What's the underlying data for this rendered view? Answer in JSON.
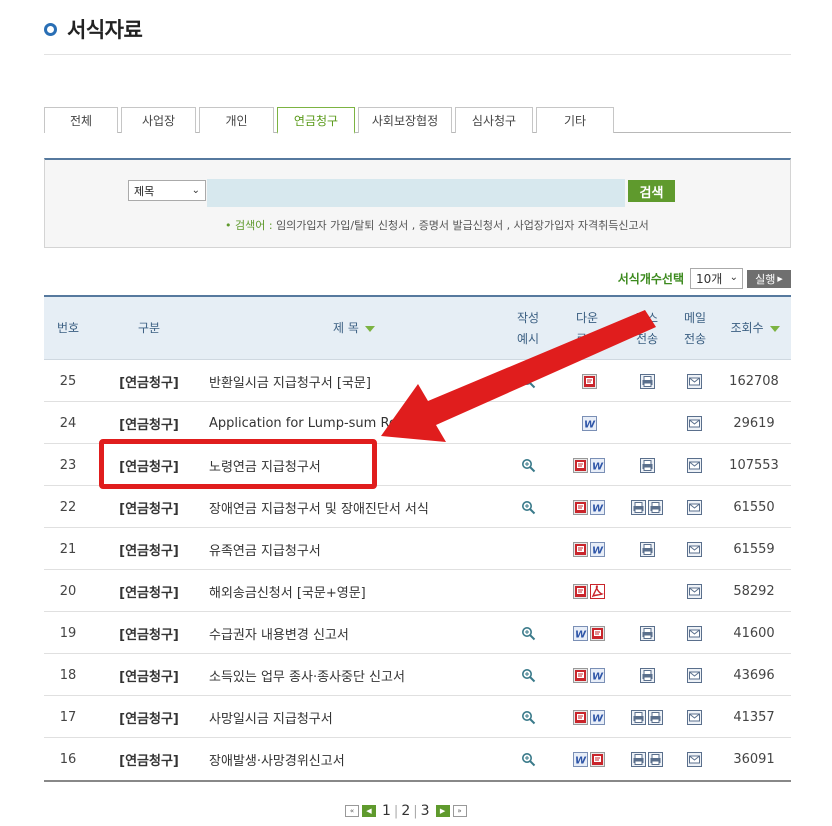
{
  "page": {
    "title": "서식자료"
  },
  "tabs": [
    {
      "label": "전체",
      "active": false
    },
    {
      "label": "사업장",
      "active": false
    },
    {
      "label": "개인",
      "active": false
    },
    {
      "label": "연금청구",
      "active": true
    },
    {
      "label": "사회보장협정",
      "active": false
    },
    {
      "label": "심사청구",
      "active": false
    },
    {
      "label": "기타",
      "active": false
    }
  ],
  "search": {
    "select_value": "제목",
    "input_value": "",
    "button_label": "검색",
    "hint_prefix": "검색어 : ",
    "hint_text": "임의가입자 가입/탈퇴 신청서 , 증명서 발급신청서 , 사업장가입자 자격취득신고서"
  },
  "count_bar": {
    "label": "서식개수선택",
    "select_value": "10개",
    "run_label": "실행"
  },
  "columns": {
    "no": "번호",
    "category": "구분",
    "title": "제 목",
    "example_l1": "작성",
    "example_l2": "예시",
    "download_l1": "다운",
    "download_l2": "로드",
    "fax_l1": "팩스",
    "fax_l2": "전송",
    "mail_l1": "메일",
    "mail_l2": "전송",
    "views": "조회수"
  },
  "rows": [
    {
      "no": "25",
      "category": "[연금청구]",
      "title": "반환일시금 지급청구서 [국문]",
      "example": true,
      "downloads": [
        "pdf"
      ],
      "fax": 1,
      "mail": true,
      "views": "162708"
    },
    {
      "no": "24",
      "category": "[연금청구]",
      "title": "Application for Lump-sum Refund",
      "example": false,
      "downloads": [
        "word"
      ],
      "fax": 0,
      "mail": true,
      "views": "29619"
    },
    {
      "no": "23",
      "category": "[연금청구]",
      "title": "노령연금 지급청구서",
      "example": true,
      "downloads": [
        "pdf",
        "word"
      ],
      "fax": 1,
      "mail": true,
      "views": "107553"
    },
    {
      "no": "22",
      "category": "[연금청구]",
      "title": "장애연금 지급청구서 및 장애진단서 서식",
      "example": true,
      "downloads": [
        "pdf",
        "word"
      ],
      "fax": 2,
      "mail": true,
      "views": "61550"
    },
    {
      "no": "21",
      "category": "[연금청구]",
      "title": "유족연금 지급청구서",
      "example": false,
      "downloads": [
        "pdf",
        "word"
      ],
      "fax": 1,
      "mail": true,
      "views": "61559"
    },
    {
      "no": "20",
      "category": "[연금청구]",
      "title": "해외송금신청서 [국문+영문]",
      "example": false,
      "downloads": [
        "pdf",
        "acrobat"
      ],
      "fax": 0,
      "mail": true,
      "views": "58292"
    },
    {
      "no": "19",
      "category": "[연금청구]",
      "title": "수급권자 내용변경 신고서",
      "example": true,
      "downloads": [
        "word",
        "pdf"
      ],
      "fax": 1,
      "mail": true,
      "views": "41600"
    },
    {
      "no": "18",
      "category": "[연금청구]",
      "title": "소득있는 업무 종사·종사중단 신고서",
      "example": true,
      "downloads": [
        "pdf",
        "word"
      ],
      "fax": 1,
      "mail": true,
      "views": "43696"
    },
    {
      "no": "17",
      "category": "[연금청구]",
      "title": "사망일시금 지급청구서",
      "example": true,
      "downloads": [
        "pdf",
        "word"
      ],
      "fax": 2,
      "mail": true,
      "views": "41357"
    },
    {
      "no": "16",
      "category": "[연금청구]",
      "title": "장애발생·사망경위신고서",
      "example": true,
      "downloads": [
        "word",
        "pdf"
      ],
      "fax": 2,
      "mail": true,
      "views": "36091"
    }
  ],
  "pager": {
    "pages": [
      "1",
      "2",
      "3"
    ],
    "current": "1"
  },
  "colors": {
    "accent_green": "#5f9a2d",
    "header_blue": "#56799e",
    "annotation_red": "#e01d1d"
  },
  "icons": {
    "example": "magnifier-icon",
    "pdf": "pdf-file-icon",
    "word": "word-file-icon",
    "acrobat": "acrobat-icon",
    "fax": "fax-icon",
    "mail": "mail-icon"
  }
}
